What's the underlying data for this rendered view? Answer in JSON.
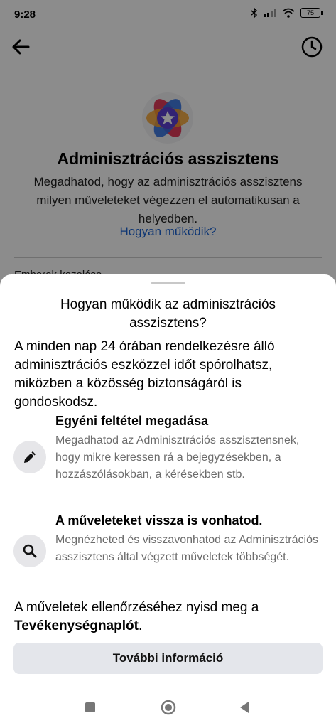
{
  "status_bar": {
    "time": "9:28",
    "battery": "75"
  },
  "background_page": {
    "title": "Adminisztrációs asszisztens",
    "description": "Megadhatod, hogy az adminisztrációs asszisztens milyen műveleteket végezzen el automatikusan a helyedben.",
    "link": "Hogyan működik?",
    "row_label": "Emberek kezelése"
  },
  "sheet": {
    "title": "Hogyan működik az adminisztrációs asszisztens?",
    "intro": "A minden nap 24 órában rendelkezésre álló adminisztrációs eszközzel időt spórolhatsz, miközben a közösség biztonságáról is gondoskodsz.",
    "features": [
      {
        "icon": "pencil-icon",
        "heading": "Egyéni feltétel megadása",
        "body": "Megadhatod az Adminisztrációs asszisztensnek, hogy mikre keressen rá a bejegyzésekben, a hozzászólásokban, a kérésekben stb."
      },
      {
        "icon": "search-icon",
        "heading": "A műveleteket vissza is vonhatod.",
        "body": "Megnézheted és visszavonhatod az Adminisztrációs asszisztens által végzett műveletek többségét."
      }
    ],
    "footer_text": "A műveletek ellenőrzéséhez nyisd meg a",
    "footer_bold": "Tevékenységnaplót",
    "footer_end": ".",
    "button_label": "További információ"
  },
  "colors": {
    "link": "#1b63d3",
    "button_bg": "#e4e6eb",
    "overlay": "rgba(0,0,0,0.45)"
  }
}
